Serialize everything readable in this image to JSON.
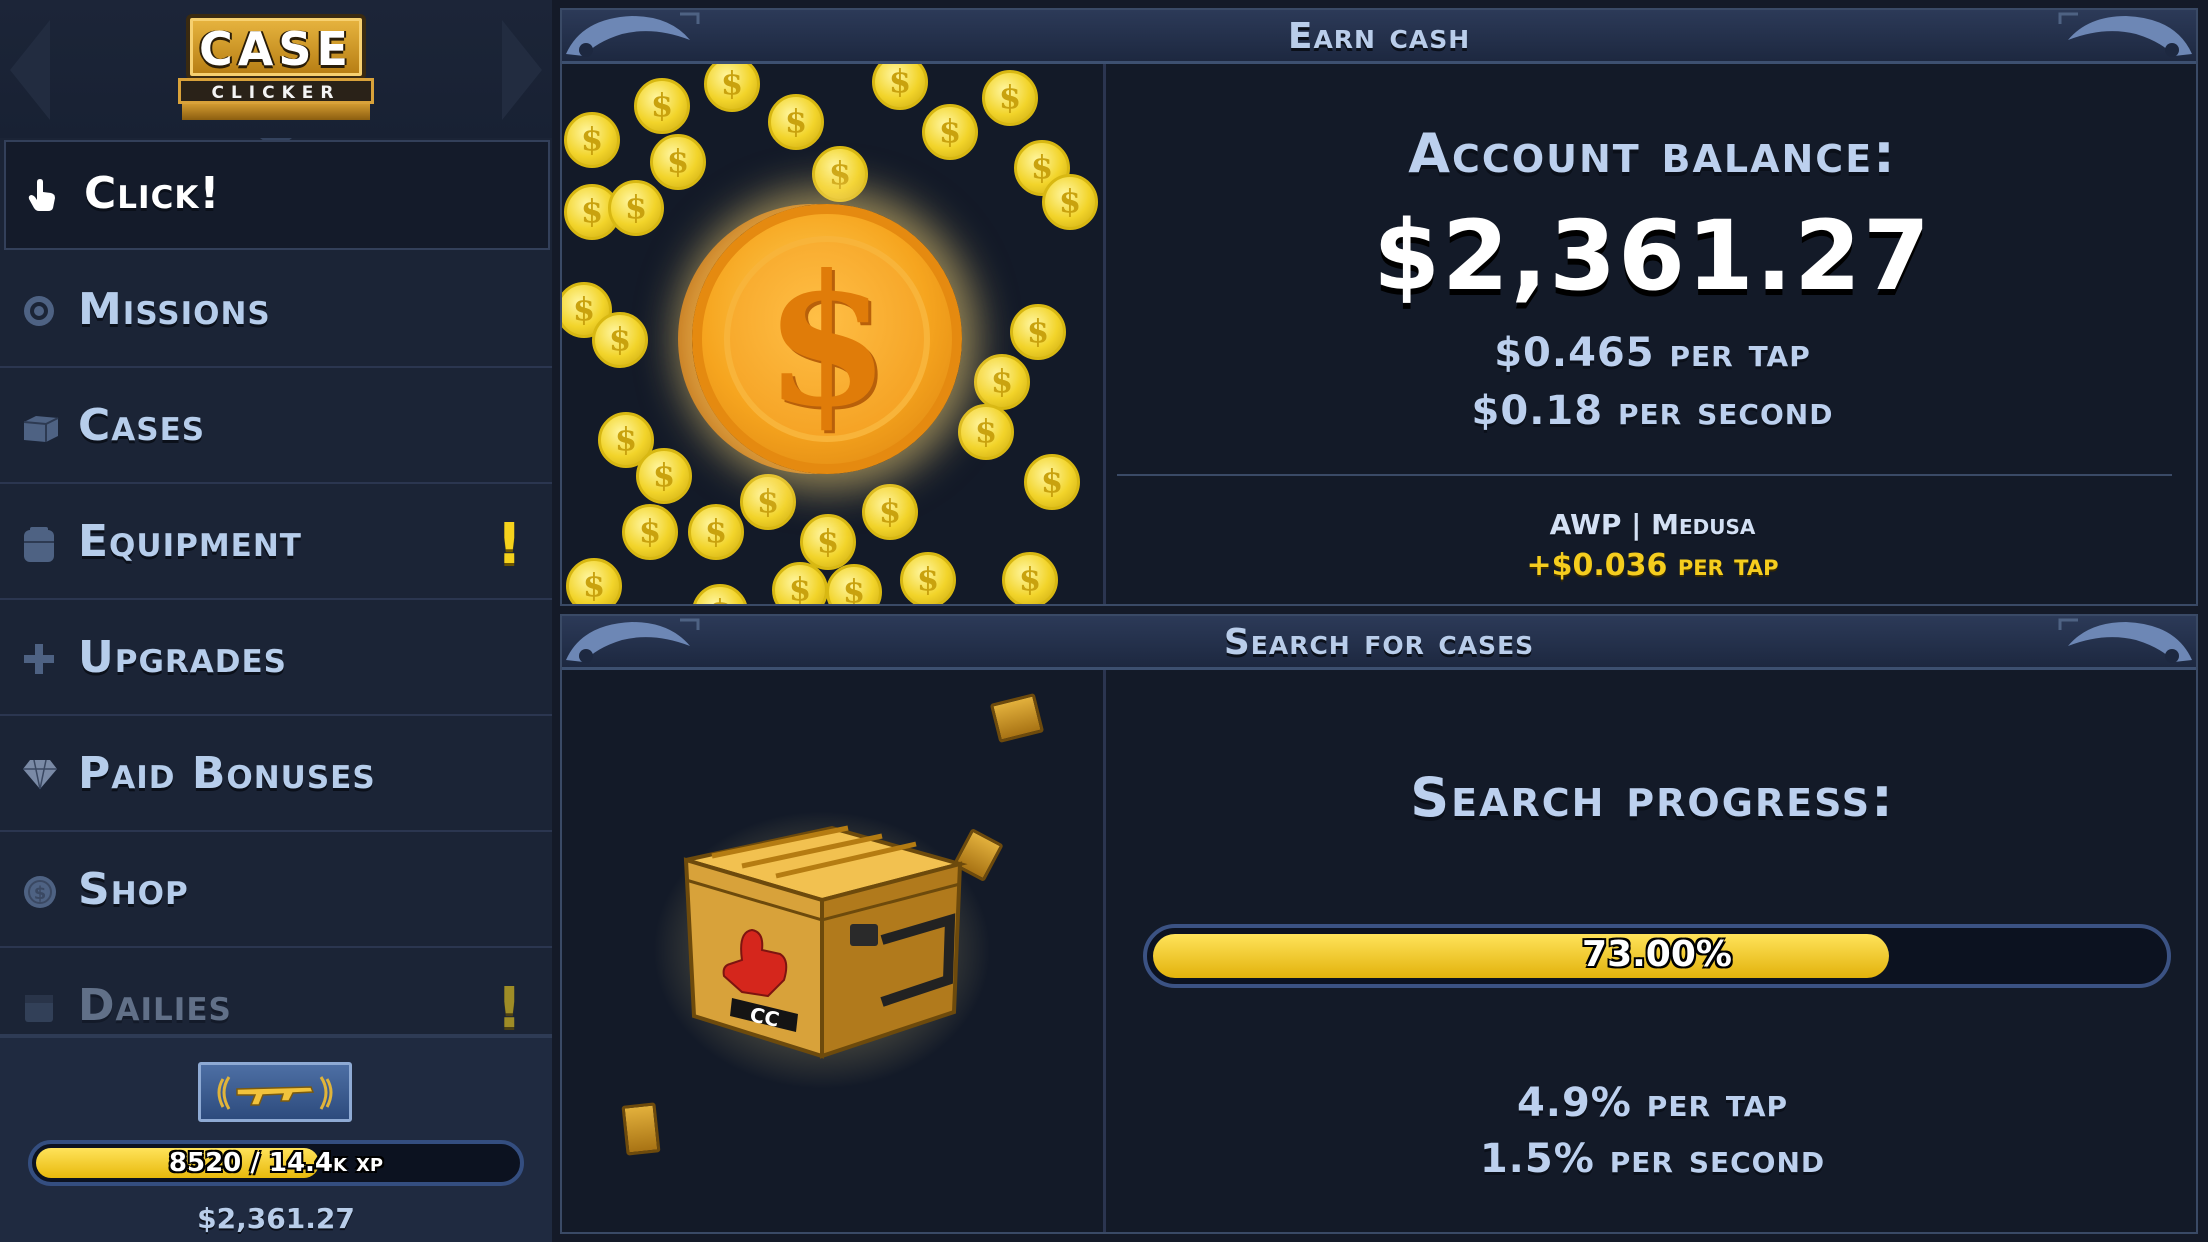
{
  "logo": {
    "case": "CASE",
    "clicker": "CLICKER"
  },
  "nav": {
    "items": [
      {
        "label": "Click!",
        "icon": "pointer-hand-icon",
        "active": true
      },
      {
        "label": "Missions",
        "icon": "target-icon"
      },
      {
        "label": "Cases",
        "icon": "crate-icon"
      },
      {
        "label": "Equipment",
        "icon": "locker-icon",
        "alert": "!"
      },
      {
        "label": "Upgrades",
        "icon": "plus-icon"
      },
      {
        "label": "Paid Bonuses",
        "icon": "diamond-icon"
      },
      {
        "label": "Shop",
        "icon": "coin-icon"
      },
      {
        "label": "Dailies",
        "icon": "calendar-icon",
        "alert": "!"
      }
    ]
  },
  "footer": {
    "rank_icon": "ak47-rank-badge-icon",
    "xp_text": "8520 / 14.4k xp",
    "xp_progress": 0.59,
    "balance": "$2,361.27"
  },
  "earn": {
    "title": "Earn cash",
    "balance_label": "Account balance:",
    "balance_value": "$2,361.27",
    "per_tap": "$0.465 per tap",
    "per_second": "$0.18 per second",
    "weapon": "AWP | Medusa",
    "weapon_bonus": "+$0.036 per tap"
  },
  "search": {
    "title": "Search for cases",
    "progress_label": "Search progress:",
    "progress_text": "73.00%",
    "progress": 0.73,
    "per_tap": "4.9% per tap",
    "per_second": "1.5% per second",
    "crate_label": "CC"
  },
  "colors": {
    "accent_gold": "#f5cd1e",
    "panel_bg": "#131a28",
    "sidebar_bg": "#1b2436",
    "label_blue": "#bcd0ee"
  }
}
